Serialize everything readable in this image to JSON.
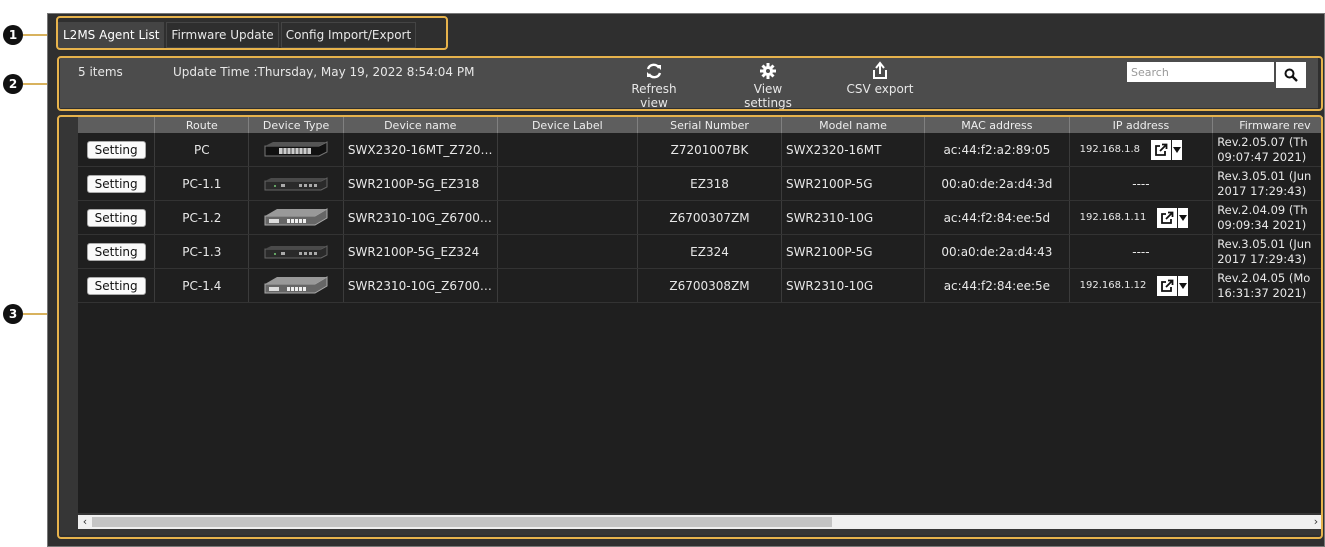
{
  "tabs": [
    "L2MS Agent List",
    "Firmware Update",
    "Config Import/Export"
  ],
  "toolbar": {
    "count": "5 items",
    "update_label": "Update Time :",
    "update_time": "Thursday, May 19, 2022 8:54:04 PM",
    "refresh": "Refresh view",
    "view_settings": "View settings",
    "csv_export": "CSV export",
    "search_placeholder": "Search"
  },
  "callouts": [
    "1",
    "2",
    "3"
  ],
  "table": {
    "columns": [
      "Route",
      "Device Type",
      "Device name",
      "Device Label",
      "Serial Number",
      "Model name",
      "MAC address",
      "IP address",
      "Firmware rev"
    ],
    "setting_label": "Setting",
    "rows": [
      {
        "route": "PC",
        "device_icon": "switch-16port-icon",
        "device_name": "SWX2320-16MT_Z720…",
        "label": "",
        "serial": "Z7201007BK",
        "model": "SWX2320-16MT",
        "mac": "ac:44:f2:a2:89:05",
        "ip": "192.168.1.8",
        "fw1": "Rev.2.05.07 (Th",
        "fw2": "09:07:47 2021)"
      },
      {
        "route": "PC-1.1",
        "device_icon": "switch-5port-icon",
        "device_name": "SWR2100P-5G_EZ318",
        "label": "",
        "serial": "EZ318",
        "model": "SWR2100P-5G",
        "mac": "00:a0:de:2a:d4:3d",
        "ip": "----",
        "fw1": "Rev.3.05.01 (Jun",
        "fw2": "2017 17:29:43)"
      },
      {
        "route": "PC-1.2",
        "device_icon": "switch-10port-icon",
        "device_name": "SWR2310-10G_Z6700…",
        "label": "",
        "serial": "Z6700307ZM",
        "model": "SWR2310-10G",
        "mac": "ac:44:f2:84:ee:5d",
        "ip": "192.168.1.11",
        "fw1": "Rev.2.04.09 (Th",
        "fw2": "09:09:34 2021)"
      },
      {
        "route": "PC-1.3",
        "device_icon": "switch-5port-icon",
        "device_name": "SWR2100P-5G_EZ324",
        "label": "",
        "serial": "EZ324",
        "model": "SWR2100P-5G",
        "mac": "00:a0:de:2a:d4:43",
        "ip": "----",
        "fw1": "Rev.3.05.01 (Jun",
        "fw2": "2017 17:29:43)"
      },
      {
        "route": "PC-1.4",
        "device_icon": "switch-10port-icon",
        "device_name": "SWR2310-10G_Z6700…",
        "label": "",
        "serial": "Z6700308ZM",
        "model": "SWR2310-10G",
        "mac": "ac:44:f2:84:ee:5e",
        "ip": "192.168.1.12",
        "fw1": "Rev.2.04.05 (Mo",
        "fw2": "16:31:37 2021)"
      }
    ]
  },
  "colors": {
    "highlight": "#e7b34c",
    "panel": "#4c4c4c",
    "header": "#5e5e5e",
    "table_bg": "#1f1f1f"
  }
}
